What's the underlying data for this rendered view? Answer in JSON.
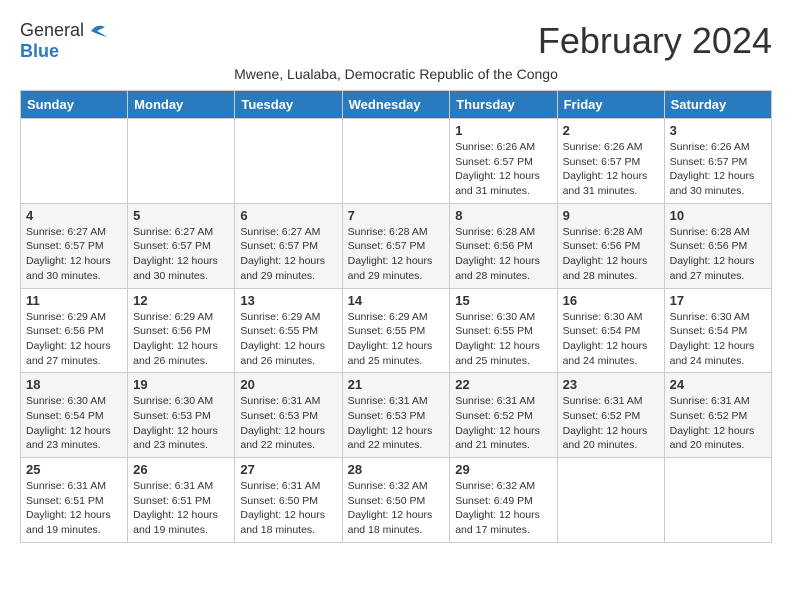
{
  "logo": {
    "general": "General",
    "blue": "Blue"
  },
  "title": "February 2024",
  "subtitle": "Mwene, Lualaba, Democratic Republic of the Congo",
  "days_of_week": [
    "Sunday",
    "Monday",
    "Tuesday",
    "Wednesday",
    "Thursday",
    "Friday",
    "Saturday"
  ],
  "weeks": [
    [
      {
        "day": "",
        "info": ""
      },
      {
        "day": "",
        "info": ""
      },
      {
        "day": "",
        "info": ""
      },
      {
        "day": "",
        "info": ""
      },
      {
        "day": "1",
        "info": "Sunrise: 6:26 AM\nSunset: 6:57 PM\nDaylight: 12 hours and 31 minutes."
      },
      {
        "day": "2",
        "info": "Sunrise: 6:26 AM\nSunset: 6:57 PM\nDaylight: 12 hours and 31 minutes."
      },
      {
        "day": "3",
        "info": "Sunrise: 6:26 AM\nSunset: 6:57 PM\nDaylight: 12 hours and 30 minutes."
      }
    ],
    [
      {
        "day": "4",
        "info": "Sunrise: 6:27 AM\nSunset: 6:57 PM\nDaylight: 12 hours and 30 minutes."
      },
      {
        "day": "5",
        "info": "Sunrise: 6:27 AM\nSunset: 6:57 PM\nDaylight: 12 hours and 30 minutes."
      },
      {
        "day": "6",
        "info": "Sunrise: 6:27 AM\nSunset: 6:57 PM\nDaylight: 12 hours and 29 minutes."
      },
      {
        "day": "7",
        "info": "Sunrise: 6:28 AM\nSunset: 6:57 PM\nDaylight: 12 hours and 29 minutes."
      },
      {
        "day": "8",
        "info": "Sunrise: 6:28 AM\nSunset: 6:56 PM\nDaylight: 12 hours and 28 minutes."
      },
      {
        "day": "9",
        "info": "Sunrise: 6:28 AM\nSunset: 6:56 PM\nDaylight: 12 hours and 28 minutes."
      },
      {
        "day": "10",
        "info": "Sunrise: 6:28 AM\nSunset: 6:56 PM\nDaylight: 12 hours and 27 minutes."
      }
    ],
    [
      {
        "day": "11",
        "info": "Sunrise: 6:29 AM\nSunset: 6:56 PM\nDaylight: 12 hours and 27 minutes."
      },
      {
        "day": "12",
        "info": "Sunrise: 6:29 AM\nSunset: 6:56 PM\nDaylight: 12 hours and 26 minutes."
      },
      {
        "day": "13",
        "info": "Sunrise: 6:29 AM\nSunset: 6:55 PM\nDaylight: 12 hours and 26 minutes."
      },
      {
        "day": "14",
        "info": "Sunrise: 6:29 AM\nSunset: 6:55 PM\nDaylight: 12 hours and 25 minutes."
      },
      {
        "day": "15",
        "info": "Sunrise: 6:30 AM\nSunset: 6:55 PM\nDaylight: 12 hours and 25 minutes."
      },
      {
        "day": "16",
        "info": "Sunrise: 6:30 AM\nSunset: 6:54 PM\nDaylight: 12 hours and 24 minutes."
      },
      {
        "day": "17",
        "info": "Sunrise: 6:30 AM\nSunset: 6:54 PM\nDaylight: 12 hours and 24 minutes."
      }
    ],
    [
      {
        "day": "18",
        "info": "Sunrise: 6:30 AM\nSunset: 6:54 PM\nDaylight: 12 hours and 23 minutes."
      },
      {
        "day": "19",
        "info": "Sunrise: 6:30 AM\nSunset: 6:53 PM\nDaylight: 12 hours and 23 minutes."
      },
      {
        "day": "20",
        "info": "Sunrise: 6:31 AM\nSunset: 6:53 PM\nDaylight: 12 hours and 22 minutes."
      },
      {
        "day": "21",
        "info": "Sunrise: 6:31 AM\nSunset: 6:53 PM\nDaylight: 12 hours and 22 minutes."
      },
      {
        "day": "22",
        "info": "Sunrise: 6:31 AM\nSunset: 6:52 PM\nDaylight: 12 hours and 21 minutes."
      },
      {
        "day": "23",
        "info": "Sunrise: 6:31 AM\nSunset: 6:52 PM\nDaylight: 12 hours and 20 minutes."
      },
      {
        "day": "24",
        "info": "Sunrise: 6:31 AM\nSunset: 6:52 PM\nDaylight: 12 hours and 20 minutes."
      }
    ],
    [
      {
        "day": "25",
        "info": "Sunrise: 6:31 AM\nSunset: 6:51 PM\nDaylight: 12 hours and 19 minutes."
      },
      {
        "day": "26",
        "info": "Sunrise: 6:31 AM\nSunset: 6:51 PM\nDaylight: 12 hours and 19 minutes."
      },
      {
        "day": "27",
        "info": "Sunrise: 6:31 AM\nSunset: 6:50 PM\nDaylight: 12 hours and 18 minutes."
      },
      {
        "day": "28",
        "info": "Sunrise: 6:32 AM\nSunset: 6:50 PM\nDaylight: 12 hours and 18 minutes."
      },
      {
        "day": "29",
        "info": "Sunrise: 6:32 AM\nSunset: 6:49 PM\nDaylight: 12 hours and 17 minutes."
      },
      {
        "day": "",
        "info": ""
      },
      {
        "day": "",
        "info": ""
      }
    ]
  ]
}
